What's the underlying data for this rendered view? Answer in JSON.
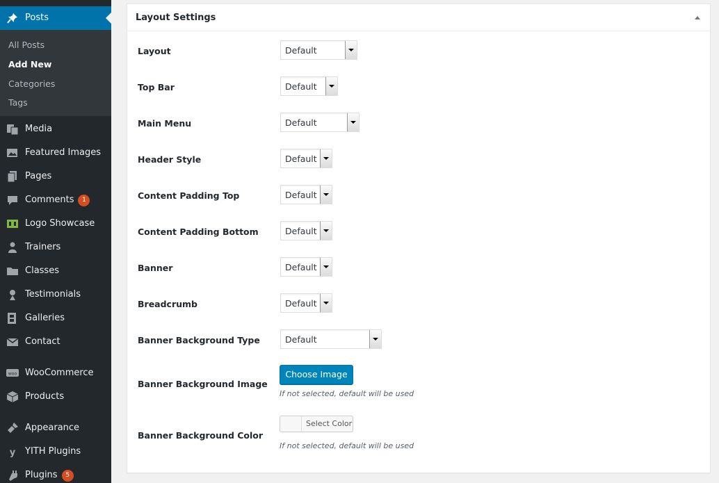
{
  "sidebar": {
    "active": {
      "label": "Posts",
      "icon": "pushpin-icon"
    },
    "submenu": [
      {
        "label": "All Posts"
      },
      {
        "label": "Add New"
      },
      {
        "label": "Categories"
      },
      {
        "label": "Tags"
      }
    ],
    "items": [
      {
        "label": "Media",
        "icon": "media-icon"
      },
      {
        "label": "Featured Images",
        "icon": "images-icon"
      },
      {
        "label": "Pages",
        "icon": "pages-icon"
      },
      {
        "label": "Comments",
        "icon": "comments-icon",
        "badge": "1"
      },
      {
        "label": "Logo Showcase",
        "icon": "logo-showcase-icon"
      },
      {
        "label": "Trainers",
        "icon": "user-icon"
      },
      {
        "label": "Classes",
        "icon": "folder-icon"
      },
      {
        "label": "Testimonials",
        "icon": "testimonial-icon"
      },
      {
        "label": "Galleries",
        "icon": "gallery-icon"
      },
      {
        "label": "Contact",
        "icon": "mail-icon"
      },
      {
        "label": "WooCommerce",
        "icon": "woocommerce-icon"
      },
      {
        "label": "Products",
        "icon": "box-icon"
      },
      {
        "label": "Appearance",
        "icon": "paintbrush-icon"
      },
      {
        "label": "YITH Plugins",
        "icon": "yith-icon"
      },
      {
        "label": "Plugins",
        "icon": "plug-icon",
        "badge": "5"
      }
    ]
  },
  "panel": {
    "title": "Layout Settings",
    "fields": [
      {
        "label": "Layout",
        "value": "Default"
      },
      {
        "label": "Top Bar",
        "value": "Default"
      },
      {
        "label": "Main Menu",
        "value": "Default"
      },
      {
        "label": "Header Style",
        "value": "Default"
      },
      {
        "label": "Content Padding Top",
        "value": "Default"
      },
      {
        "label": "Content Padding Bottom",
        "value": "Default"
      },
      {
        "label": "Banner",
        "value": "Default"
      },
      {
        "label": "Breadcrumb",
        "value": "Default"
      },
      {
        "label": "Banner Background Type",
        "value": "Default"
      }
    ],
    "banner_image": {
      "label": "Banner Background Image",
      "button": "Choose Image",
      "hint": "If not selected, default will be used"
    },
    "banner_color": {
      "label": "Banner Background Color",
      "button": "Select Color",
      "hint": "If not selected, default will be used"
    }
  },
  "colors": {
    "sidebar_bg": "#23282d",
    "submenu_bg": "#32373c",
    "accent": "#0073aa",
    "button": "#0085ba",
    "badge": "#d54e21"
  }
}
